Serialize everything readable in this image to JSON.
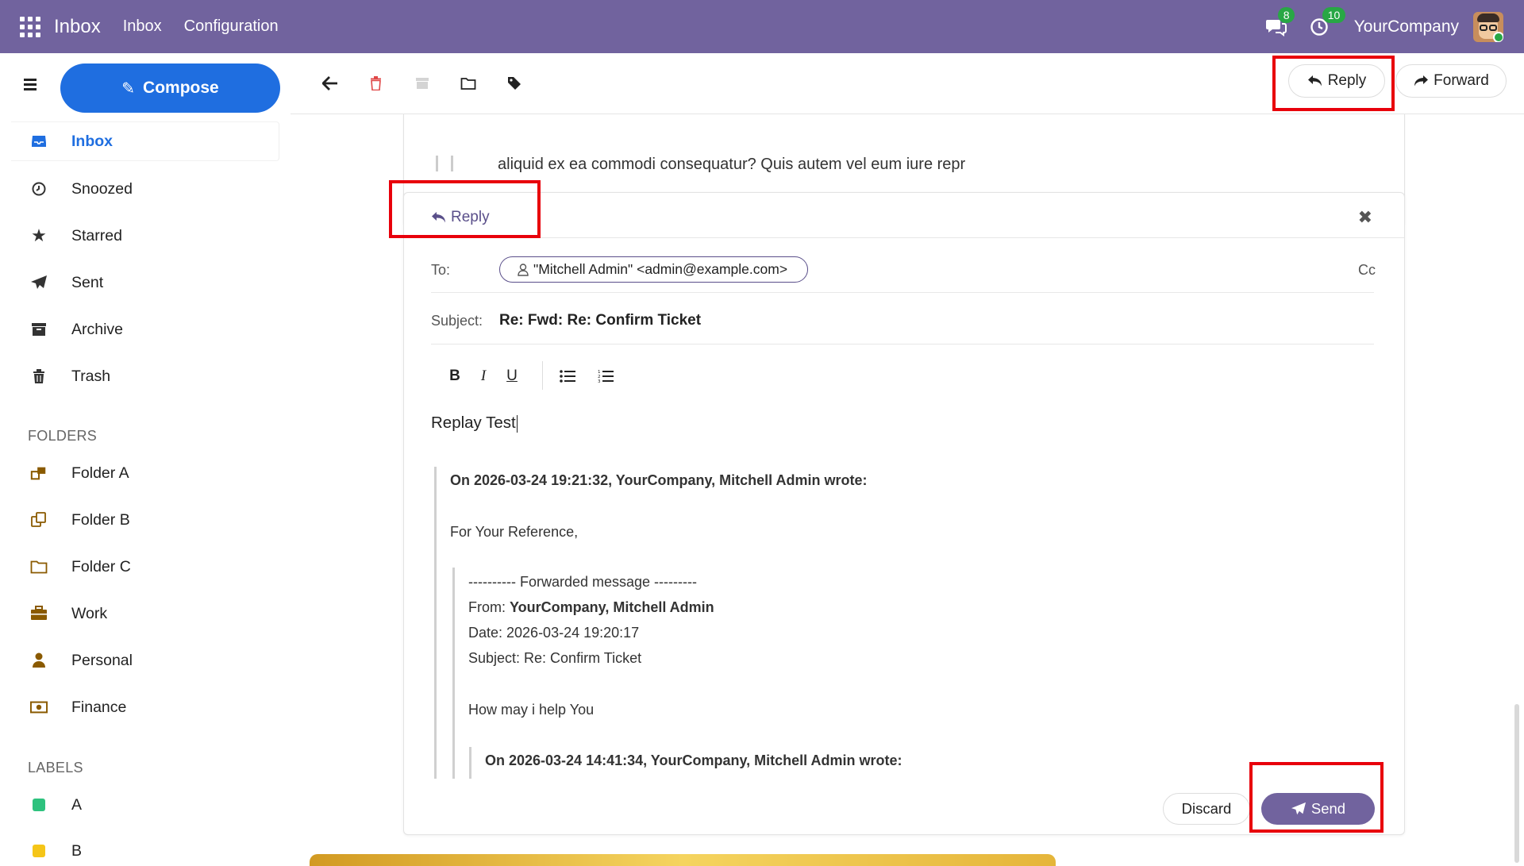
{
  "navbar": {
    "app_name": "Inbox",
    "links": [
      "Inbox",
      "Configuration"
    ],
    "chat_badge": "8",
    "activity_badge": "10",
    "company": "YourCompany"
  },
  "sidebar": {
    "compose_label": "Compose",
    "items": [
      {
        "label": "Inbox",
        "icon": "inbox-icon"
      },
      {
        "label": "Snoozed",
        "icon": "clock-icon"
      },
      {
        "label": "Starred",
        "icon": "star-icon"
      },
      {
        "label": "Sent",
        "icon": "paper-plane-icon"
      },
      {
        "label": "Archive",
        "icon": "archive-icon"
      },
      {
        "label": "Trash",
        "icon": "trash-icon"
      }
    ],
    "folders_title": "FOLDERS",
    "folders": [
      {
        "label": "Folder A",
        "icon": "folder-network-icon"
      },
      {
        "label": "Folder B",
        "icon": "folder-copy-icon"
      },
      {
        "label": "Folder C",
        "icon": "folder-icon"
      },
      {
        "label": "Work",
        "icon": "briefcase-icon"
      },
      {
        "label": "Personal",
        "icon": "user-icon"
      },
      {
        "label": "Finance",
        "icon": "money-icon"
      }
    ],
    "labels_title": "LABELS",
    "labels": [
      {
        "label": "A",
        "color": "#2ec27e"
      },
      {
        "label": "B",
        "color": "#f5c518"
      }
    ]
  },
  "toolbar": {
    "reply_label": "Reply",
    "forward_label": "Forward"
  },
  "previous_message": {
    "text": "aliquid ex ea commodi consequatur? Quis autem vel eum iure repr"
  },
  "reply": {
    "title": "Reply",
    "to_label": "To:",
    "to_value": "\"Mitchell Admin\" <admin@example.com>",
    "cc_label": "Cc",
    "subject_label": "Subject:",
    "subject_value": "Re: Fwd: Re: Confirm Ticket",
    "body": "Replay Test",
    "quote": {
      "header": "On 2026-03-24 19:21:32, YourCompany, Mitchell Admin wrote:",
      "line1": "For Your Reference,",
      "fwd_header": "---------- Forwarded message ---------",
      "from_label": "From: ",
      "from_value": "YourCompany, Mitchell Admin",
      "date_line": "Date: 2026-03-24 19:20:17",
      "subject_line": "Subject: Re: Confirm Ticket",
      "help_line": "How may i help You",
      "nested_header": "On 2026-03-24 14:41:34, YourCompany, Mitchell Admin wrote:"
    },
    "discard_label": "Discard",
    "send_label": "Send"
  }
}
